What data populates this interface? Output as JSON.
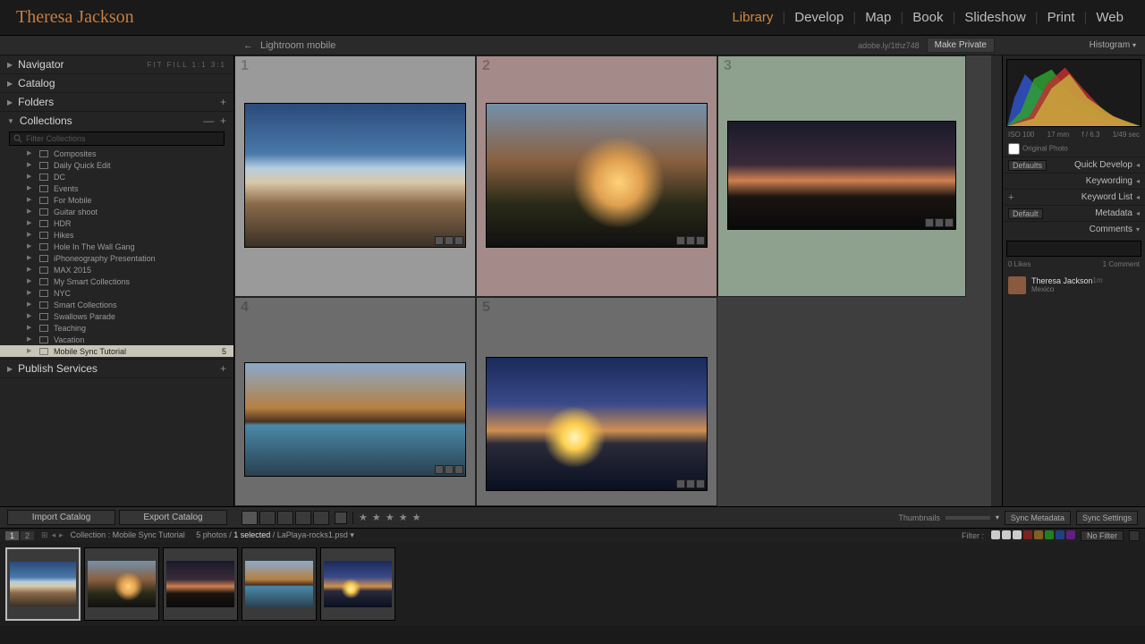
{
  "identity": "Theresa Jackson",
  "modules": [
    "Library",
    "Develop",
    "Map",
    "Book",
    "Slideshow",
    "Print",
    "Web"
  ],
  "active_module": "Library",
  "breadcrumb_icon": "←",
  "breadcrumb": "Lightroom mobile",
  "adobe_link": "adobe.ly/1thz748",
  "make_private": "Make Private",
  "histogram_label": "Histogram",
  "left": {
    "navigator": {
      "label": "Navigator",
      "opts": "FIT  FILL  1:1  3:1"
    },
    "catalog": "Catalog",
    "folders": "Folders",
    "collections": "Collections",
    "filter_placeholder": "Filter Collections",
    "items": [
      {
        "label": "Composites"
      },
      {
        "label": "Daily Quick Edit"
      },
      {
        "label": "DC"
      },
      {
        "label": "Events"
      },
      {
        "label": "For Mobile"
      },
      {
        "label": "Guitar shoot"
      },
      {
        "label": "HDR"
      },
      {
        "label": "Hikes"
      },
      {
        "label": "Hole In The Wall Gang"
      },
      {
        "label": "iPhoneography Presentation"
      },
      {
        "label": "MAX 2015"
      },
      {
        "label": "My Smart Collections"
      },
      {
        "label": "NYC"
      },
      {
        "label": "Smart Collections"
      },
      {
        "label": "Swallows Parade"
      },
      {
        "label": "Teaching"
      },
      {
        "label": "Vacation"
      },
      {
        "label": "Mobile Sync Tutorial",
        "count": "5",
        "selected": true
      }
    ],
    "publish": "Publish Services",
    "import_btn": "Import Catalog",
    "export_btn": "Export Catalog"
  },
  "grid": {
    "cells": [
      {
        "n": "1",
        "klass": "sky-beach"
      },
      {
        "n": "2",
        "klass": "sky-forest"
      },
      {
        "n": "3",
        "klass": "sky-dusk"
      },
      {
        "n": "4",
        "klass": "sky-lake"
      },
      {
        "n": "5",
        "klass": "sky-sunset"
      }
    ]
  },
  "right": {
    "histo_info": {
      "iso": "ISO 100",
      "mm": "17 mm",
      "f": "f / 6.3",
      "s": "1/49 sec"
    },
    "original_photo": "Original Photo",
    "quick_develop": {
      "preset": "Defaults",
      "label": "Quick Develop"
    },
    "keywording": "Keywording",
    "keyword_list": "Keyword List",
    "metadata": {
      "preset": "Default",
      "label": "Metadata"
    },
    "comments": "Comments",
    "likes": "0 Likes",
    "comment_count": "1 Comment",
    "author": "Theresa Jackson",
    "author_time": "1m",
    "author_loc": "Mexico"
  },
  "toolbar": {
    "thumbnails": "Thumbnails",
    "sync_meta": "Sync Metadata",
    "sync_settings": "Sync Settings",
    "stars": "★ ★ ★ ★ ★"
  },
  "filterbar": {
    "pages": [
      "1",
      "2"
    ],
    "path_label": "Collection : ",
    "path_value": "Mobile Sync Tutorial",
    "count_text": "5 photos / ",
    "selected_text": "1 selected",
    "filename": " / LaPlaya-rocks1.psd ▾",
    "filter_label": "Filter :",
    "no_filter": "No Filter",
    "flag_colors": [
      "#802020",
      "#806020",
      "#208020",
      "#204080",
      "#602080"
    ]
  }
}
